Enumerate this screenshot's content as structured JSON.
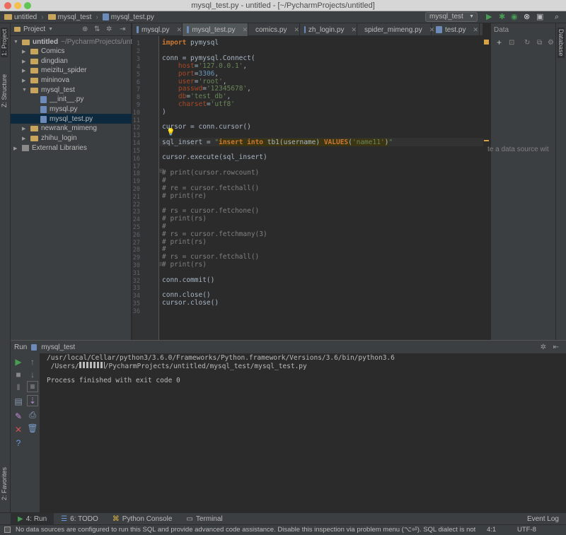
{
  "window": {
    "title": "mysql_test.py - untitled - [~/PycharmProjects/untitled]"
  },
  "navbar": {
    "crumbs": [
      "untitled",
      "mysql_test",
      "mysql_test.py"
    ]
  },
  "run_config": {
    "label": "mysql_test"
  },
  "left_strip": {
    "project": "1: Project",
    "structure": "Z: Structure",
    "favorites": "2: Favorites"
  },
  "right_strip": {
    "database": "Database"
  },
  "project": {
    "header": "Project",
    "root_name": "untitled",
    "root_path": "~/PycharmProjects/untitl",
    "items": [
      {
        "label": "Comics"
      },
      {
        "label": "dingdian"
      },
      {
        "label": "meizitu_spider"
      },
      {
        "label": "mininova"
      },
      {
        "label": "mysql_test"
      },
      {
        "label": "__init__.py"
      },
      {
        "label": "mysql.py"
      },
      {
        "label": "mysql_test.py"
      },
      {
        "label": "newrank_mimeng"
      },
      {
        "label": "zhihu_login"
      },
      {
        "label": "External Libraries"
      }
    ]
  },
  "tabs": [
    {
      "label": "mysql.py"
    },
    {
      "label": "mysql_test.py"
    },
    {
      "label": "comics.py"
    },
    {
      "label": "zh_login.py"
    },
    {
      "label": "spider_mimeng.py"
    },
    {
      "label": "test.py"
    }
  ],
  "db_panel": {
    "tab": "Data",
    "hint": "te a data source wit"
  },
  "code": {
    "line_numbers": [
      "1",
      "2",
      "3",
      "4",
      "5",
      "6",
      "7",
      "8",
      "9",
      "10",
      "11",
      "12",
      "13",
      "14",
      "15",
      "16",
      "17",
      "18",
      "19",
      "20",
      "21",
      "22",
      "23",
      "24",
      "25",
      "26",
      "27",
      "28",
      "29",
      "30",
      "31",
      "32",
      "33",
      "34",
      "35",
      "36"
    ],
    "l1_kw": "import",
    "l1_rest": " pymysql",
    "l3": "conn = pymysql.Connect(",
    "l4_p": "    host",
    "l4_s": "'127.0.0.1'",
    "l5_p": "    port",
    "l5_n": "3306",
    "l6_p": "    user",
    "l6_s": "'root'",
    "l7_p": "    passwd",
    "l7_s": "'12345678'",
    "l8_p": "    db",
    "l8_s": "'test_db'",
    "l9_p": "    charset",
    "l9_s": "'utf8'",
    "l10": ")",
    "l12": "cursor = conn.cursor()",
    "l14_a": "sql_insert = ",
    "l14_q1": "\"",
    "l14_k1": "insert into",
    "l14_m": " tb1(username) ",
    "l14_k2": "VALUES",
    "l14_p1": "(",
    "l14_s": "'name11'",
    "l14_p2": ")",
    "l14_q2": "\"",
    "l16": "cursor.execute(sql_insert)",
    "l18": "# print(cursor.rowcount)",
    "l19": "#",
    "l20": "# re = cursor.fetchall()",
    "l21": "# print(re)",
    "l23": "# rs = cursor.fetchone()",
    "l24": "# print(rs)",
    "l25": "#",
    "l26": "# rs = cursor.fetchmany(3)",
    "l27": "# print(rs)",
    "l28": "#",
    "l29": "# rs = cursor.fetchall()",
    "l30": "# print(rs)",
    "l32": "conn.commit()",
    "l34": "conn.close()",
    "l35": "cursor.close()"
  },
  "run": {
    "title_prefix": "Run",
    "title_name": "mysql_test",
    "line1": "/usr/local/Cellar/python3/3.6.0/Frameworks/Python.framework/Versions/3.6/bin/python3.6",
    "line2_a": " /Users/",
    "line2_b": "/PycharmProjects/untitled/mysql_test/mysql_test.py",
    "line3": "Process finished with exit code 0"
  },
  "bottom_tabs": [
    {
      "label": "4: Run"
    },
    {
      "label": "6: TODO"
    },
    {
      "label": "Python Console"
    },
    {
      "label": "Terminal"
    },
    {
      "label": "Event Log"
    }
  ],
  "status": {
    "message": "No data sources are configured to run this SQL and provide advanced code assistance. Disable this inspection via problem menu (⌥⏎). SQL dialect is not configured.",
    "position": "4:1",
    "encoding": "UTF-8"
  },
  "colors": {
    "accent": "#499c54",
    "bg": "#2b2b2b",
    "panel": "#3c3f41",
    "keyword": "#cc7832",
    "string": "#6a8759",
    "number": "#6897bb",
    "param": "#aa4926",
    "comment": "#808080"
  },
  "icons": [
    "folder-icon",
    "python-file-icon",
    "run-icon",
    "debug-icon",
    "stop-icon",
    "search-icon",
    "settings-icon"
  ]
}
